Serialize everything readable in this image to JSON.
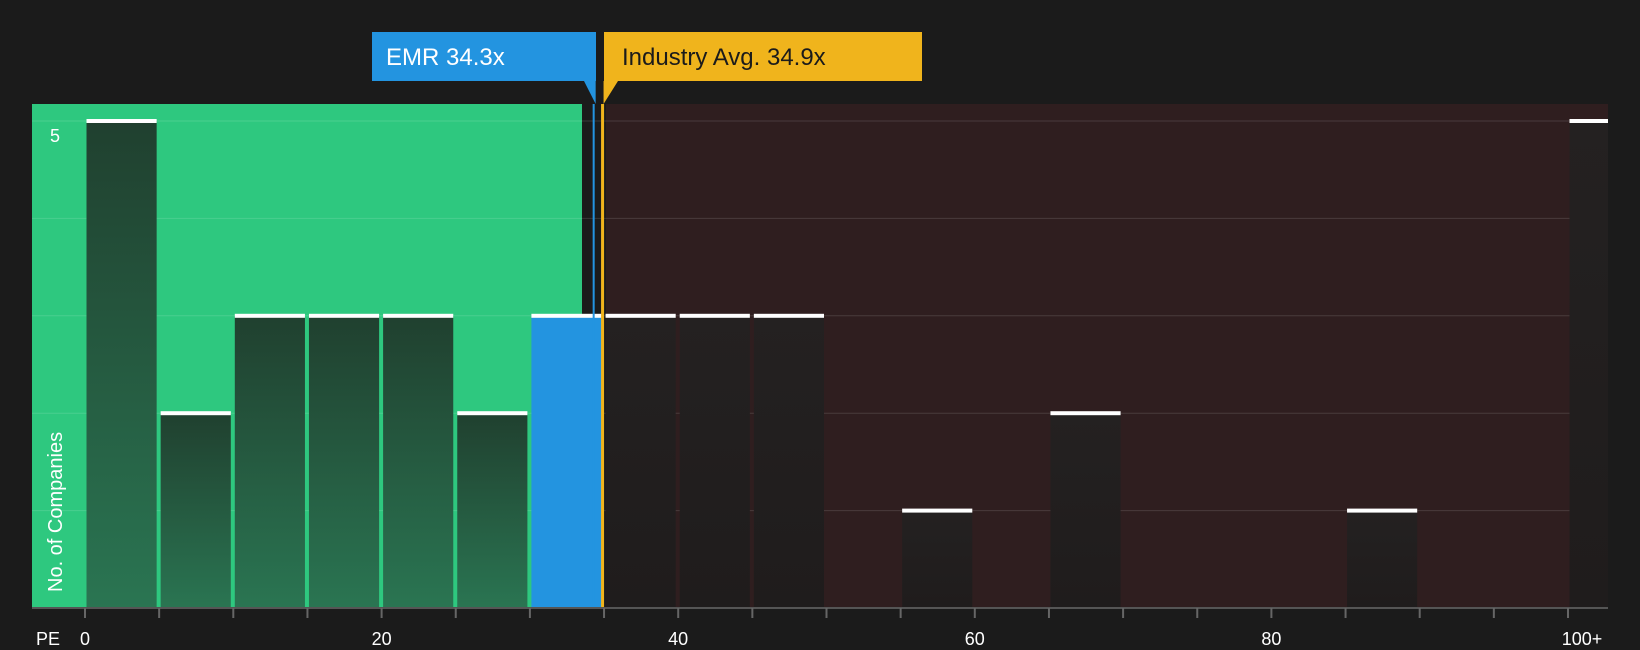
{
  "chart_data": {
    "type": "bar",
    "xlabel": "PE",
    "ylabel": "No. of Companies",
    "xlim": [
      0,
      100
    ],
    "ylim": [
      0,
      5
    ],
    "x_ticks": [
      0,
      20,
      40,
      60,
      80,
      "100+"
    ],
    "y_ticks": [
      5
    ],
    "bin_width": 5,
    "bins": [
      {
        "x0": 0,
        "x1": 5,
        "value": 5
      },
      {
        "x0": 5,
        "x1": 10,
        "value": 2
      },
      {
        "x0": 10,
        "x1": 15,
        "value": 3
      },
      {
        "x0": 15,
        "x1": 20,
        "value": 3
      },
      {
        "x0": 20,
        "x1": 25,
        "value": 3
      },
      {
        "x0": 25,
        "x1": 30,
        "value": 2
      },
      {
        "x0": 30,
        "x1": 35,
        "value": 3,
        "highlight": true
      },
      {
        "x0": 35,
        "x1": 40,
        "value": 3
      },
      {
        "x0": 40,
        "x1": 45,
        "value": 3
      },
      {
        "x0": 45,
        "x1": 50,
        "value": 3
      },
      {
        "x0": 55,
        "x1": 60,
        "value": 1
      },
      {
        "x0": 65,
        "x1": 70,
        "value": 2
      },
      {
        "x0": 85,
        "x1": 90,
        "value": 1
      },
      {
        "x0": 100,
        "x1": 105,
        "value": 5
      }
    ],
    "markers": [
      {
        "name": "emr",
        "label": "EMR 34.3x",
        "value": 34.3,
        "color": "#2394e0"
      },
      {
        "name": "industry",
        "label": "Industry Avg. 34.9x",
        "value": 34.9,
        "color": "#f0b41c"
      }
    ],
    "grid": true
  },
  "colors": {
    "background": "#1b1b1b",
    "undervalued_zone": "#2ec87f",
    "overvalued_zone": "#2f1e1f",
    "bar_fill": "#222222",
    "bar_cap": "#ffffff",
    "highlight_bar": "#2394e0"
  }
}
